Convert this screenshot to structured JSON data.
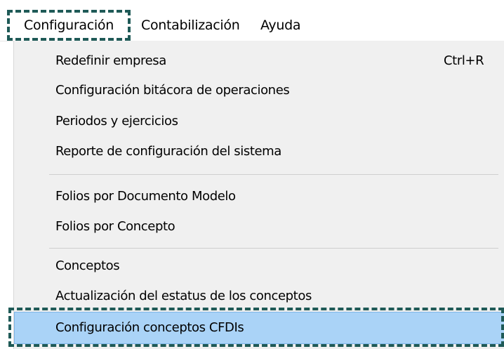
{
  "menubar": {
    "items": [
      {
        "label": "Configuración"
      },
      {
        "label": "Contabilización"
      },
      {
        "label": "Ayuda"
      }
    ]
  },
  "dropdown": {
    "items": [
      {
        "label": "Redefinir empresa",
        "shortcut": "Ctrl+R"
      },
      {
        "label": "Configuración bitácora de operaciones"
      },
      {
        "label": "Periodos y ejercicios"
      },
      {
        "label": "Reporte de configuración del sistema"
      },
      {
        "label": "Folios por Documento Modelo"
      },
      {
        "label": "Folios por Concepto"
      },
      {
        "label": "Conceptos"
      },
      {
        "label": "Actualización del estatus de los conceptos"
      },
      {
        "label": "Configuración conceptos CFDIs"
      }
    ]
  },
  "colors": {
    "highlight_fill": "#aad3f7",
    "annotation_border": "#1f5a57",
    "menu_background": "#f0f0f0"
  }
}
